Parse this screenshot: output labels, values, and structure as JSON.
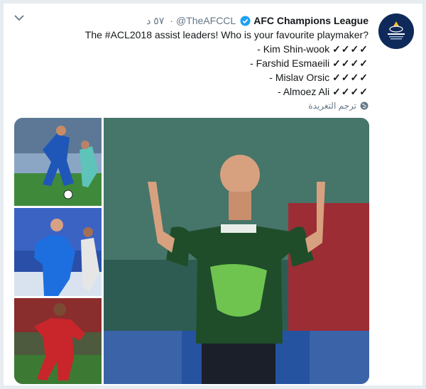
{
  "tweet": {
    "display_name": "AFC Champions League",
    "handle": "@TheAFCCL",
    "time": "٥٧ د",
    "lines": [
      "The #ACL2018 assist leaders! Who is your favourite playmaker?",
      "- Kim Shin-wook",
      "- Farshid Esmaeili",
      "- Mislav Orsic",
      "- Almoez Ali"
    ],
    "checks": "✓✓✓✓",
    "translate_label": "ترجم التغريدة"
  },
  "icons": {
    "menu": "chevron-down-icon",
    "verified": "verified-badge-icon",
    "translate": "globe-icon",
    "avatar": "afc-champions-league-logo"
  },
  "colors": {
    "verified": "#1da1f2",
    "muted": "#657786",
    "avatar_bg": "#0f2a5a",
    "jersey_green": "#1f4d2a",
    "neon_green": "#7ed957"
  },
  "media": {
    "photos": [
      "player-blue-esteghlal",
      "player-blue-ulsan",
      "player-red-qatar",
      "player-green-jeonbuk"
    ]
  }
}
